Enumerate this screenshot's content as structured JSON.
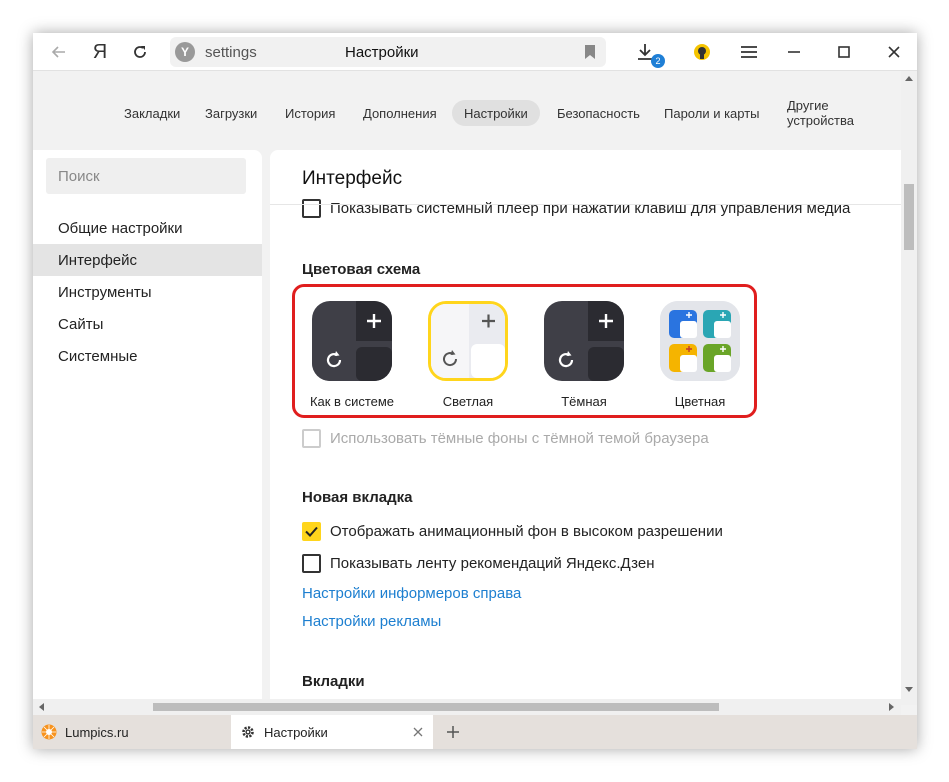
{
  "toolbar": {
    "back_icon": "arrow-left-icon",
    "logo": "Я",
    "reload_icon": "reload-icon",
    "downloads_count": "2"
  },
  "address": {
    "url": "settings",
    "title": "Настройки"
  },
  "settings_nav": [
    {
      "label": "Закладки"
    },
    {
      "label": "Загрузки"
    },
    {
      "label": "История"
    },
    {
      "label": "Дополнения"
    },
    {
      "label": "Настройки",
      "active": true
    },
    {
      "label": "Безопасность"
    },
    {
      "label": "Пароли и карты"
    },
    {
      "label": "Другие устройства"
    }
  ],
  "sidebar": {
    "search_placeholder": "Поиск",
    "items": [
      {
        "label": "Общие настройки"
      },
      {
        "label": "Интерфейс",
        "active": true
      },
      {
        "label": "Инструменты"
      },
      {
        "label": "Сайты"
      },
      {
        "label": "Системные"
      }
    ]
  },
  "main": {
    "title": "Интерфейс",
    "media_player_option": "Показывать системный плеер при нажатии клавиш для управления медиа",
    "color_scheme": {
      "heading": "Цветовая схема",
      "themes": [
        {
          "label": "Как в системе"
        },
        {
          "label": "Светлая",
          "selected": true
        },
        {
          "label": "Тёмная"
        },
        {
          "label": "Цветная"
        }
      ]
    },
    "dark_bg_option": "Использовать тёмные фоны с тёмной темой браузера",
    "new_tab": {
      "heading": "Новая вкладка",
      "animated_bg": "Отображать анимационный фон в высоком разрешении",
      "zen_feed": "Показывать ленту рекомендаций Яндекс.Дзен",
      "informers_link": "Настройки информеров справа",
      "ads_link": "Настройки рекламы"
    },
    "tabs_heading": "Вкладки"
  },
  "tabs": [
    {
      "label": "Lumpics.ru"
    },
    {
      "label": "Настройки",
      "active": true
    }
  ],
  "colors": {
    "accent_yellow": "#ffd51c",
    "link_blue": "#1d7fd0",
    "highlight_red": "#e01e1e",
    "dark_theme": "#3f3f47"
  }
}
